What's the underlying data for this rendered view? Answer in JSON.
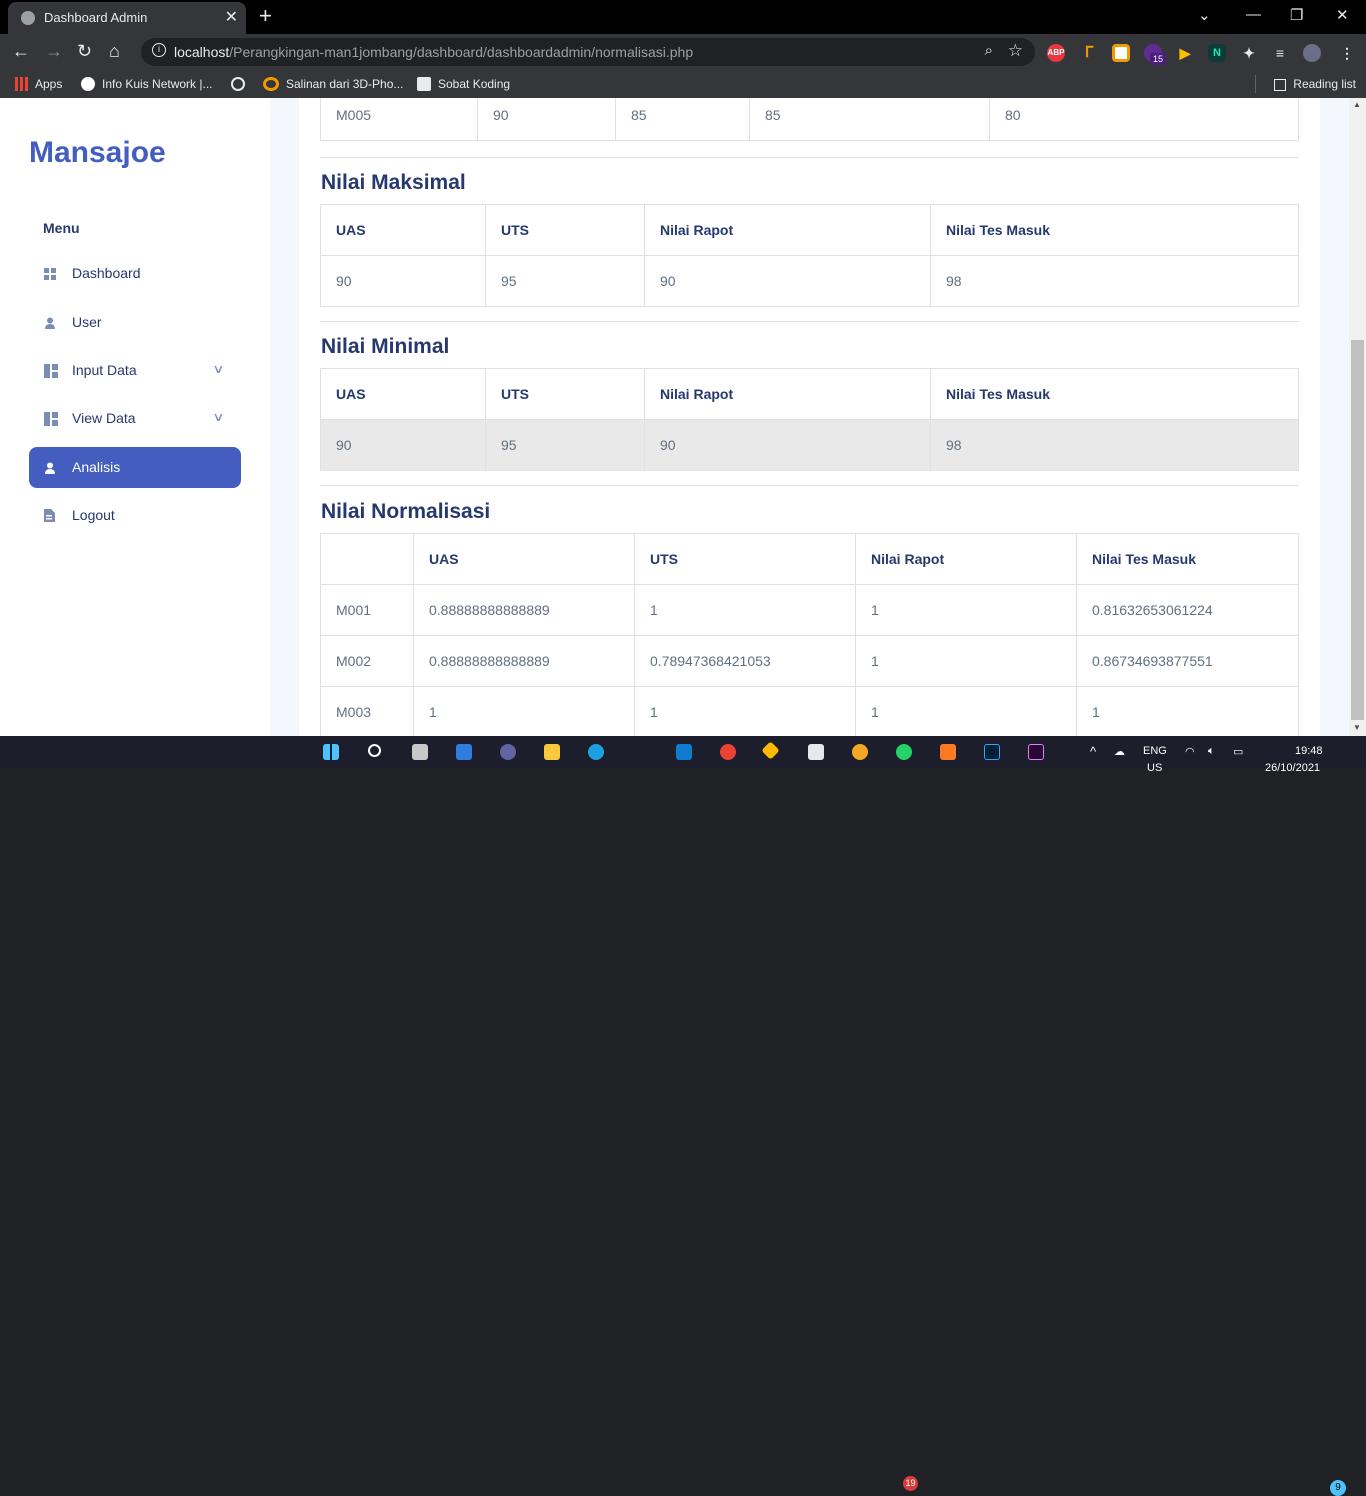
{
  "browser": {
    "tab_title": "Dashboard Admin",
    "url_host": "localhost",
    "url_path": "/Perangkingan-man1jombang/dashboard/dashboardadmin/normalisasi.php",
    "bookmarks": [
      "Apps",
      "Info Kuis Network |...",
      "Salinan dari 3D-Pho...",
      "Sobat Koding"
    ],
    "reading_list": "Reading list",
    "ext_abp": "ABP",
    "ext_badge": "15"
  },
  "sidebar": {
    "brand": "Mansajoe",
    "menu_title": "Menu",
    "items": [
      {
        "label": "Dashboard",
        "icon": "grid-icon"
      },
      {
        "label": "User",
        "icon": "person-icon"
      },
      {
        "label": "Input Data",
        "icon": "layout-icon"
      },
      {
        "label": "View Data",
        "icon": "layout-icon"
      },
      {
        "label": "Analisis",
        "icon": "person-icon"
      },
      {
        "label": "Logout",
        "icon": "file-icon"
      }
    ]
  },
  "top_table": {
    "row": [
      "M005",
      "90",
      "85",
      "85",
      "80"
    ]
  },
  "nilai_maksimal": {
    "title": "Nilai Maksimal",
    "headers": [
      "UAS",
      "UTS",
      "Nilai Rapot",
      "Nilai Tes Masuk"
    ],
    "values": [
      "90",
      "95",
      "90",
      "98"
    ]
  },
  "nilai_minimal": {
    "title": "Nilai Minimal",
    "headers": [
      "UAS",
      "UTS",
      "Nilai Rapot",
      "Nilai Tes Masuk"
    ],
    "values": [
      "90",
      "95",
      "90",
      "98"
    ]
  },
  "nilai_normalisasi": {
    "title": "Nilai Normalisasi",
    "headers": [
      "",
      "UAS",
      "UTS",
      "Nilai Rapot",
      "Nilai Tes Masuk"
    ],
    "rows": [
      [
        "M001",
        "0.88888888888889",
        "1",
        "1",
        "0.81632653061224"
      ],
      [
        "M002",
        "0.88888888888889",
        "0.78947368421053",
        "1",
        "0.86734693877551"
      ],
      [
        "M003",
        "1",
        "1",
        "1",
        "1"
      ]
    ]
  },
  "taskbar": {
    "lang": "ENG",
    "lang2": "US",
    "time": "19:48",
    "date": "26/10/2021",
    "notif_count": "9",
    "whatsapp_badge": "19"
  }
}
